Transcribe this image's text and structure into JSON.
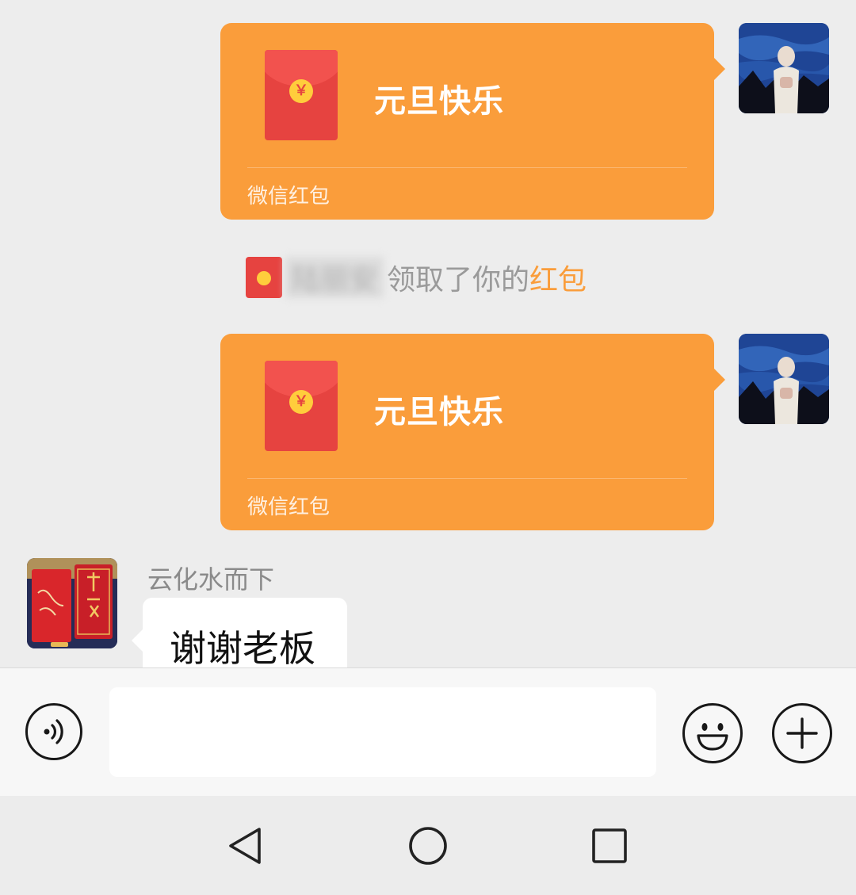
{
  "messages": {
    "red_packet_1": {
      "title": "元旦快乐",
      "footer": "微信红包",
      "coin_symbol": "￥"
    },
    "notice": {
      "name": "陆丽安",
      "text": "领取了你的",
      "link": "红包"
    },
    "red_packet_2": {
      "title": "元旦快乐",
      "footer": "微信红包",
      "coin_symbol": "￥"
    },
    "incoming": {
      "sender": "云化水而下",
      "text": "谢谢老板"
    }
  },
  "input_bar": {
    "voice_icon": "voice-icon",
    "emoji_icon": "emoji-icon",
    "plus_icon": "plus-icon",
    "value": ""
  },
  "nav_bar": {
    "back_icon": "back-triangle-icon",
    "home_icon": "home-circle-icon",
    "recents_icon": "recents-square-icon"
  },
  "colors": {
    "red_packet": "#fa9d3b",
    "envelope": "#e64340",
    "coin": "#ffcd3c",
    "chat_background": "#ededed"
  }
}
